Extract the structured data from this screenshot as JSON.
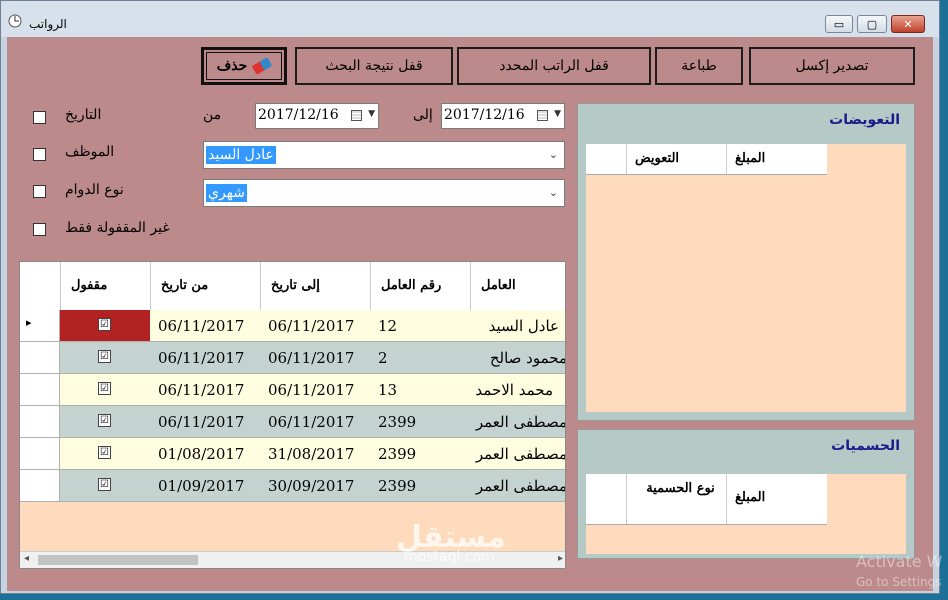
{
  "window": {
    "title": "الرواتب",
    "min_glyph": "▭",
    "max_glyph": "▢",
    "close_glyph": "✕"
  },
  "toolbar": {
    "delete_label": "حذف",
    "lock_search_label": "قفل نتيجة البحث",
    "lock_selected_label": "قفل الراتب المحدد",
    "print_label": "طباعة",
    "export_excel_label": "تصدير إكسل"
  },
  "filters": {
    "date_label": "التاريخ",
    "from_label": "من",
    "to_label": "إلى",
    "from_date": "2017/12/16",
    "to_date": "2017/12/16",
    "employee_label": "الموظف",
    "employee_value": "عادل السيد",
    "shift_type_label": "نوع الدوام",
    "shift_type_value": "شهري",
    "unlocked_only_label": "غير المقفولة فقط"
  },
  "grid": {
    "columns": [
      "العامل",
      "رقم العامل",
      "إلى تاريخ",
      "من تاريخ",
      "مقفول"
    ],
    "rows": [
      {
        "worker": "عادل السيد",
        "worker_no": "12",
        "to_date": "06/11/2017",
        "from_date": "06/11/2017",
        "locked": true
      },
      {
        "worker": "محمود صالح",
        "worker_no": "2",
        "to_date": "06/11/2017",
        "from_date": "06/11/2017",
        "locked": true
      },
      {
        "worker": "محمد الاحمد",
        "worker_no": "13",
        "to_date": "06/11/2017",
        "from_date": "06/11/2017",
        "locked": true
      },
      {
        "worker": "مصطفى العمر",
        "worker_no": "2399",
        "to_date": "06/11/2017",
        "from_date": "06/11/2017",
        "locked": true
      },
      {
        "worker": "مصطفى العمر",
        "worker_no": "2399",
        "to_date": "31/08/2017",
        "from_date": "01/08/2017",
        "locked": true
      },
      {
        "worker": "مصطفى العمر",
        "worker_no": "2399",
        "to_date": "30/09/2017",
        "from_date": "01/09/2017",
        "locked": true
      }
    ],
    "row_marker": "▸",
    "check_glyph": "☑",
    "scroll_left": "◂",
    "scroll_right": "▸"
  },
  "compensations": {
    "title": "التعويضات",
    "col_amount": "المبلغ",
    "col_compensation": "التعويض"
  },
  "deductions": {
    "title": "الحسميات",
    "col_amount": "المبلغ",
    "col_deduction_type": "نوع الحسمية"
  },
  "overlay": {
    "watermark_big": "مستقل",
    "watermark_small": "mostaql.com",
    "activate_line1": "Activate W",
    "activate_line2": "Go to Settings"
  },
  "colors": {
    "form_bg": "#bc8a8a",
    "row_even": "#fffde0",
    "row_odd": "#c5d3d0",
    "selected_cell": "#b22222",
    "panel_bg": "#b5c9c6",
    "panel_body": "#ffdbbd",
    "title_color": "#1a1a8a"
  }
}
